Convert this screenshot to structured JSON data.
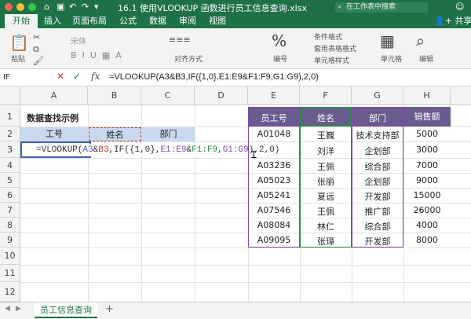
{
  "titlebar": {
    "title": "16.1 使用VLOOKUP 函数进行员工信息查询.xlsx",
    "search_placeholder": "在工作表中搜索",
    "smiley": "☺"
  },
  "ribbon_tabs": [
    "开始",
    "插入",
    "页面布局",
    "公式",
    "数据",
    "审阅",
    "视图"
  ],
  "share_label": "共享",
  "ribbon": {
    "paste": "粘贴",
    "font_name": "宋体",
    "align": "对齐方式",
    "number": "编号",
    "cond_format": "条件格式",
    "table_format": "套用表格格式",
    "cell_style": "单元格样式",
    "cells": "单元格",
    "edit": "编辑",
    "percent": "%"
  },
  "formula_bar": {
    "name_box": "IF",
    "fx": "fx",
    "formula": "=VLOOKUP(A3&B3,IF({1,0},E1:E9&F1:F9,G1:G9),2,0)"
  },
  "columns": [
    "A",
    "B",
    "C",
    "D",
    "E",
    "F",
    "G",
    "H"
  ],
  "rows": [
    "1",
    "2",
    "3",
    "4",
    "5",
    "6",
    "7",
    "8",
    "9",
    "10",
    "11",
    "12"
  ],
  "left_table": {
    "title": "数据查找示例",
    "headers": [
      "工号",
      "姓名",
      "部门"
    ]
  },
  "edit_formula": {
    "p1": "=VLOOKUP(",
    "p2": "A3",
    "p3": "&",
    "p4": "B3",
    "p5": ",IF({1,0},",
    "p6": "E1:E9",
    "p7": "&",
    "p8": "F1:F9",
    "p9": ",",
    "p10": "G1:G9",
    "p11": "),2,0)"
  },
  "right_table": {
    "headers": [
      "员工号",
      "姓名",
      "部门",
      "销售额"
    ],
    "rows": [
      [
        "A01048",
        "王巍",
        "技术支持部",
        "5000"
      ],
      [
        "",
        "刘洋",
        "企划部",
        "3000"
      ],
      [
        "A03236",
        "王佩",
        "综合部",
        "7000"
      ],
      [
        "A05023",
        "张丽",
        "企划部",
        "9000"
      ],
      [
        "A05241",
        "夏远",
        "开发部",
        "15000"
      ],
      [
        "A07546",
        "王佩",
        "推广部",
        "26000"
      ],
      [
        "A08084",
        "林仁",
        "综合部",
        "4000"
      ],
      [
        "A09095",
        "张璋",
        "开发部",
        "8000"
      ]
    ]
  },
  "sheet_tab": "员工信息查询",
  "add_sheet": "+",
  "colors": {
    "excel_green": "#1e7145",
    "header_purple": "#6b5a8e",
    "header_blue": "#c8d9f0"
  }
}
